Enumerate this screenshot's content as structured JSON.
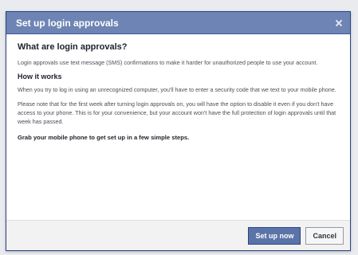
{
  "dialog": {
    "title": "Set up login approvals",
    "close_icon": "close-icon"
  },
  "content": {
    "heading": "What are login approvals?",
    "intro": "Login approvals use text message (SMS) confirmations to make it harder for unauthorized people to use your account.",
    "how_heading": "How it works",
    "how_text": "When you try to log in using an unrecognized computer, you'll have to enter a security code that we text to your mobile phone.",
    "note_text": "Please note that for the first week after turning login approvals on, you will have the option to disable it even if you don't have access to your phone. This is for your convenience, but your account won't have the full protection of login approvals until that week has passed.",
    "cta": "Grab your mobile phone to get set up in a few simple steps."
  },
  "footer": {
    "primary_label": "Set up now",
    "cancel_label": "Cancel"
  },
  "colors": {
    "header": "#6d84b4",
    "primary_button": "#5b74a8"
  }
}
